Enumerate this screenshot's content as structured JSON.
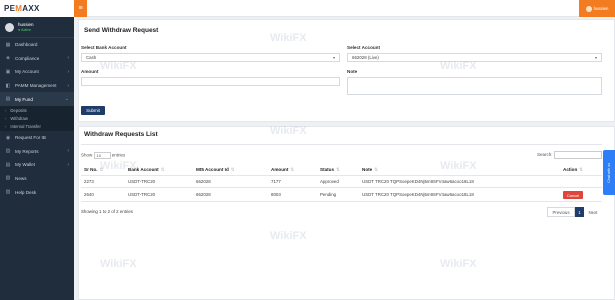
{
  "sidebar": {
    "logo_left": "PE",
    "logo_mid": "M",
    "logo_right": "AXX",
    "user": {
      "name": "hussien",
      "status": "Active"
    },
    "items": [
      {
        "label": "Dashboard",
        "icon": "dashboard-icon"
      },
      {
        "label": "Compliance",
        "icon": "shield-icon"
      },
      {
        "label": "My Account",
        "icon": "account-icon"
      },
      {
        "label": "PAMM Management",
        "icon": "chart-icon"
      },
      {
        "label": "My Fund",
        "icon": "wallet-icon"
      },
      {
        "label": "Request For IB",
        "icon": "user-plus-icon"
      },
      {
        "label": "My Reports",
        "icon": "report-icon"
      },
      {
        "label": "My Wallet",
        "icon": "wallet-icon"
      },
      {
        "label": "News",
        "icon": "news-icon"
      },
      {
        "label": "Help Desk",
        "icon": "help-icon"
      }
    ],
    "sub_items": [
      "Deposits",
      "Withdraw",
      "Internal Transfer"
    ]
  },
  "header": {
    "menu_icon": "hamburger-icon",
    "user_label": "hussien"
  },
  "form": {
    "title": "Send Withdraw Request",
    "bank_label": "Select Bank Account",
    "bank_value": "Cash",
    "account_label": "Select Account",
    "account_value": "662028 (Live)",
    "amount_label": "Amount",
    "note_label": "Note",
    "submit_label": "Submit"
  },
  "list": {
    "title": "Withdraw Requests List",
    "show_label": "Show",
    "show_value": "10",
    "entries_label": "entries",
    "search_label": "Search:",
    "columns": [
      "Sr No.",
      "Bank Account",
      "Mt5 Account Id",
      "Amount",
      "Status",
      "Note",
      "Action"
    ],
    "rows": [
      {
        "sr": "2273",
        "bank": "USDT-TRC20",
        "mt5": "662028",
        "amount": "7177",
        "status": "Approved",
        "note": "USDT TRC20 TQPSoepeKD4Nj5m9SFV4aw6acoo18L18",
        "action": ""
      },
      {
        "sr": "2640",
        "bank": "USDT-TRC20",
        "mt5": "662028",
        "amount": "8003",
        "status": "Pending",
        "note": "USDT TRC20 TQPSoepeKD4Nj5m9SFV4aw6acoo18L18",
        "action": "Cancel"
      }
    ],
    "info": "Showing 1 to 2 of 2 entries",
    "pager": {
      "prev": "Previous",
      "page": "1",
      "next": "Next"
    }
  },
  "chat_tab": "Chat with us",
  "watermark": "WikiFX",
  "colors": {
    "accent": "#f47c20",
    "sidebar": "#1f2d3d",
    "primary": "#1f3c6b",
    "danger": "#e0443a",
    "chat": "#2d7ef7"
  }
}
